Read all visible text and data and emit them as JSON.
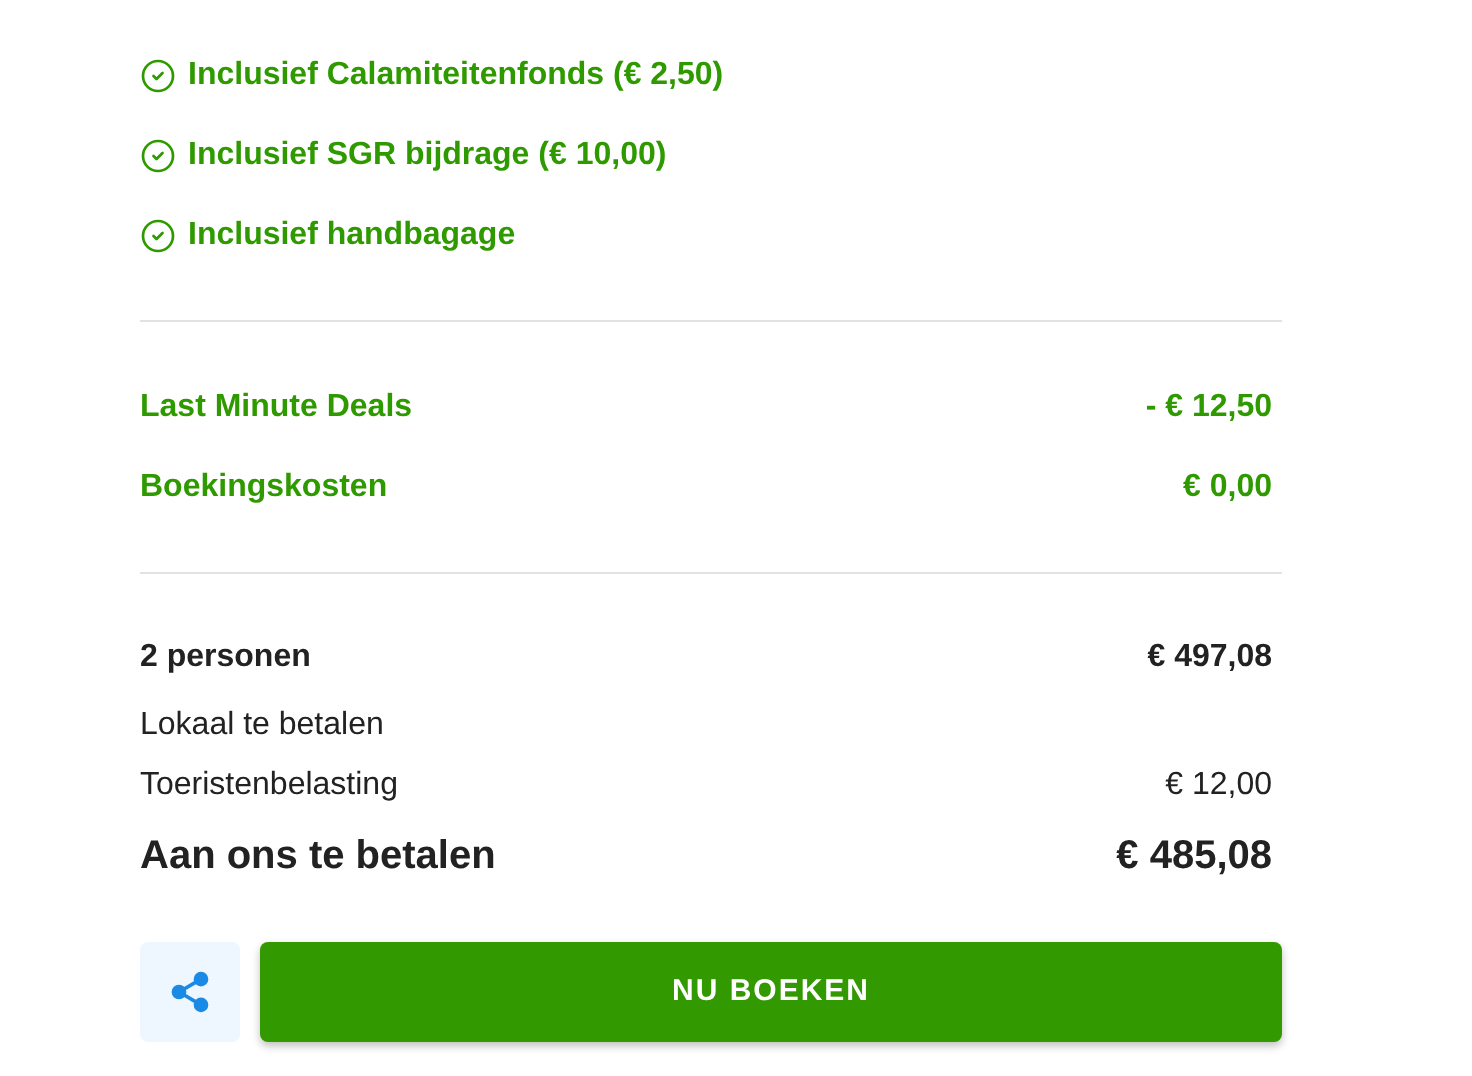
{
  "inclusions": [
    {
      "label": "Inclusief Calamiteitenfonds (€ 2,50)"
    },
    {
      "label": "Inclusief SGR bijdrage (€ 10,00)"
    },
    {
      "label": "Inclusief handbagage"
    }
  ],
  "adjustments": [
    {
      "kind": "discount",
      "label": "Last Minute Deals",
      "amount": "- € 12,50"
    },
    {
      "kind": "discount",
      "label": "Boekingskosten",
      "amount": "€ 0,00"
    }
  ],
  "summary": [
    {
      "kind": "subtotal",
      "label": "2 personen",
      "amount": "€ 497,08"
    },
    {
      "kind": "heading",
      "label": "Lokaal te betalen"
    },
    {
      "kind": "plain",
      "label": "Toeristenbelasting",
      "amount": "€ 12,00"
    },
    {
      "kind": "total",
      "label": "Aan ons te betalen",
      "amount": "€ 485,08"
    }
  ],
  "book_button": {
    "label": "NU BOEKEN"
  }
}
